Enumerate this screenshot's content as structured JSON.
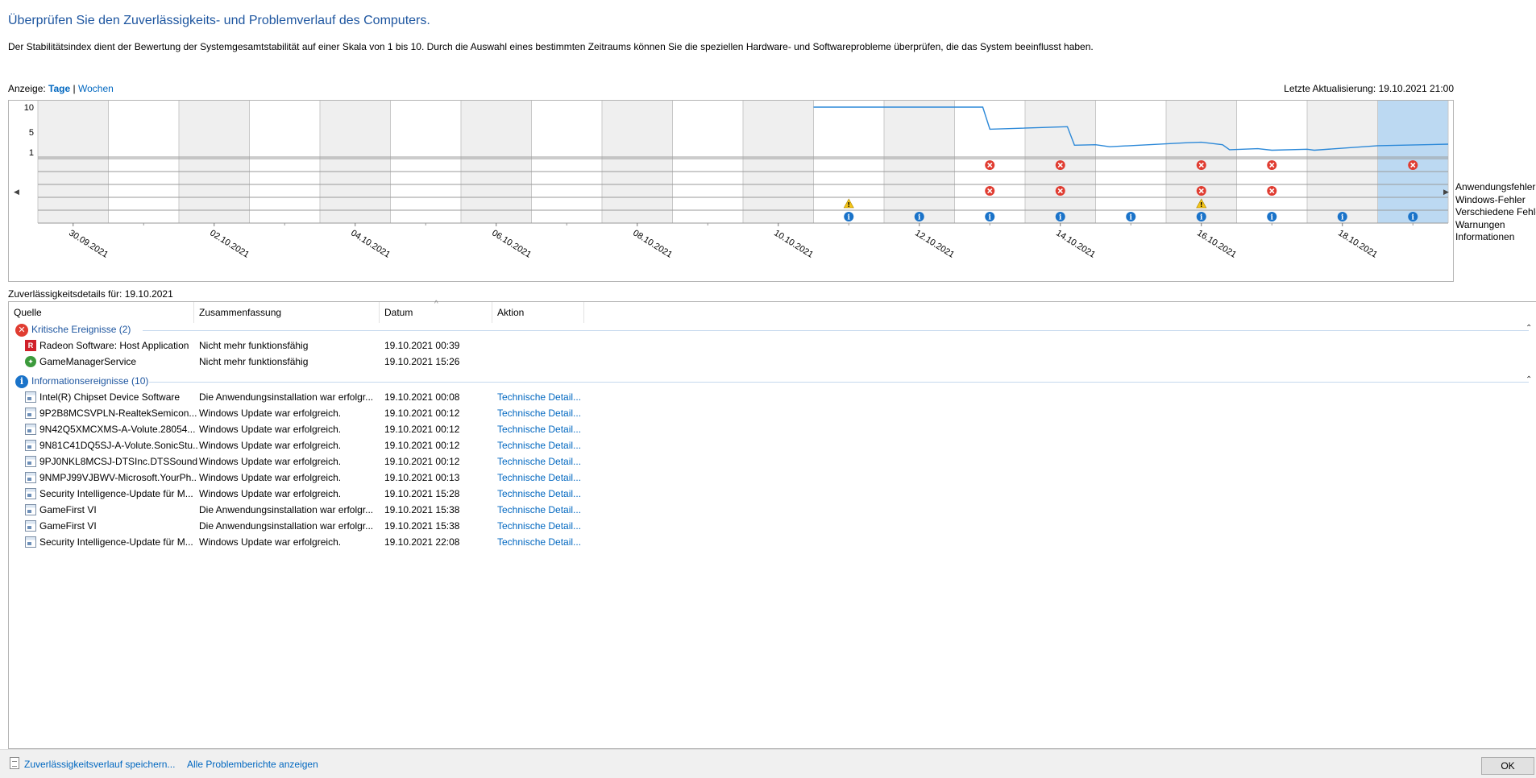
{
  "header": {
    "title": "Überprüfen Sie den Zuverlässigkeits- und Problemverlauf des Computers.",
    "description": "Der Stabilitätsindex dient der Bewertung der Systemgesamtstabilität auf einer Skala von 1 bis 10. Durch die Auswahl eines bestimmten Zeitraums können Sie die speziellen Hardware- und Softwareprobleme überprüfen, die das System beeinflusst haben."
  },
  "view": {
    "label": "Anzeige:",
    "days": "Tage",
    "separator": "|",
    "weeks": "Wochen",
    "last_update": "Letzte Aktualisierung: 19.10.2021 21:00"
  },
  "chart_data": {
    "type": "line",
    "y_ticks": [
      "10",
      "5",
      "1"
    ],
    "ylim": [
      1,
      10
    ],
    "x_labels": [
      "30.09.2021",
      "02.10.2021",
      "04.10.2021",
      "06.10.2021",
      "08.10.2021",
      "10.10.2021",
      "12.10.2021",
      "14.10.2021",
      "16.10.2021",
      "18.10.2021"
    ],
    "num_days": 20,
    "selected_day": 19,
    "stability_series": {
      "x": [
        11,
        12,
        13,
        13.4,
        13.5,
        14.6,
        14.7,
        15.0,
        15.2,
        16.3,
        16.5,
        16.8,
        16.9,
        17.3,
        17.5,
        18.0,
        18.1,
        19.0,
        20.0
      ],
      "y": [
        10,
        10,
        10,
        10,
        5.6,
        6.1,
        2.4,
        2.5,
        2.1,
        2.9,
        3.0,
        2.5,
        1.5,
        1.7,
        1.4,
        1.6,
        1.4,
        2.3,
        2.6
      ]
    },
    "rows": [
      "Anwendungsfehler",
      "Windows-Fehler",
      "Verschiedene Fehler",
      "Warnungen",
      "Informationen"
    ],
    "events": [
      {
        "row": 0,
        "day": 13,
        "kind": "error"
      },
      {
        "row": 0,
        "day": 14,
        "kind": "error"
      },
      {
        "row": 0,
        "day": 16,
        "kind": "error"
      },
      {
        "row": 0,
        "day": 17,
        "kind": "error"
      },
      {
        "row": 0,
        "day": 19,
        "kind": "error"
      },
      {
        "row": 2,
        "day": 13,
        "kind": "error"
      },
      {
        "row": 2,
        "day": 14,
        "kind": "error"
      },
      {
        "row": 2,
        "day": 16,
        "kind": "error"
      },
      {
        "row": 2,
        "day": 17,
        "kind": "error"
      },
      {
        "row": 3,
        "day": 11,
        "kind": "warning"
      },
      {
        "row": 3,
        "day": 16,
        "kind": "warning"
      },
      {
        "row": 4,
        "day": 11,
        "kind": "info"
      },
      {
        "row": 4,
        "day": 12,
        "kind": "info"
      },
      {
        "row": 4,
        "day": 13,
        "kind": "info"
      },
      {
        "row": 4,
        "day": 14,
        "kind": "info"
      },
      {
        "row": 4,
        "day": 15,
        "kind": "info"
      },
      {
        "row": 4,
        "day": 16,
        "kind": "info"
      },
      {
        "row": 4,
        "day": 17,
        "kind": "info"
      },
      {
        "row": 4,
        "day": 18,
        "kind": "info"
      },
      {
        "row": 4,
        "day": 19,
        "kind": "info"
      }
    ],
    "colors": {
      "line": "#2b88d8",
      "selected": "#bcd9f2",
      "shaded": "#efefef",
      "grid": "#c8c8c8",
      "error": "#e03c31",
      "warning": "#f5c518",
      "info": "#1a73c9"
    }
  },
  "legend": [
    "Anwendungsfehler",
    "Windows-Fehler",
    "Verschiedene Fehler",
    "Warnungen",
    "Informationen"
  ],
  "details": {
    "label": "Zuverlässigkeitsdetails für: 19.10.2021",
    "columns": [
      "Quelle",
      "Zusammenfassung",
      "Datum",
      "Aktion"
    ],
    "critical_group": "Kritische Ereignisse (2)",
    "critical": [
      {
        "source": "Radeon Software: Host Application",
        "summary": "Nicht mehr funktionsfähig",
        "date": "19.10.2021 00:39",
        "action": ""
      },
      {
        "source": "GameManagerService",
        "summary": "Nicht mehr funktionsfähig",
        "date": "19.10.2021 15:26",
        "action": ""
      }
    ],
    "info_group": "Informationsereignisse (10)",
    "info": [
      {
        "source": "Intel(R) Chipset Device Software",
        "summary": "Die Anwendungsinstallation war erfolgr...",
        "date": "19.10.2021 00:08",
        "action": "Technische Detail..."
      },
      {
        "source": "9P2B8MCSVPLN-RealtekSemicon...",
        "summary": "Windows Update war erfolgreich.",
        "date": "19.10.2021 00:12",
        "action": "Technische Detail..."
      },
      {
        "source": "9N42Q5XMCXMS-A-Volute.28054...",
        "summary": "Windows Update war erfolgreich.",
        "date": "19.10.2021 00:12",
        "action": "Technische Detail..."
      },
      {
        "source": "9N81C41DQ5SJ-A-Volute.SonicStu...",
        "summary": "Windows Update war erfolgreich.",
        "date": "19.10.2021 00:12",
        "action": "Technische Detail..."
      },
      {
        "source": "9PJ0NKL8MCSJ-DTSInc.DTSSound...",
        "summary": "Windows Update war erfolgreich.",
        "date": "19.10.2021 00:12",
        "action": "Technische Detail..."
      },
      {
        "source": "9NMPJ99VJBWV-Microsoft.YourPh...",
        "summary": "Windows Update war erfolgreich.",
        "date": "19.10.2021 00:13",
        "action": "Technische Detail..."
      },
      {
        "source": "Security Intelligence-Update für M...",
        "summary": "Windows Update war erfolgreich.",
        "date": "19.10.2021 15:28",
        "action": "Technische Detail..."
      },
      {
        "source": "GameFirst VI",
        "summary": "Die Anwendungsinstallation war erfolgr...",
        "date": "19.10.2021 15:38",
        "action": "Technische Detail..."
      },
      {
        "source": "GameFirst VI",
        "summary": "Die Anwendungsinstallation war erfolgr...",
        "date": "19.10.2021 15:38",
        "action": "Technische Detail..."
      },
      {
        "source": "Security Intelligence-Update für M...",
        "summary": "Windows Update war erfolgreich.",
        "date": "19.10.2021 22:08",
        "action": "Technische Detail..."
      }
    ]
  },
  "footer": {
    "save_link": "Zuverlässigkeitsverlauf speichern...",
    "reports_link": "Alle Problemberichte anzeigen",
    "ok_button": "OK"
  }
}
